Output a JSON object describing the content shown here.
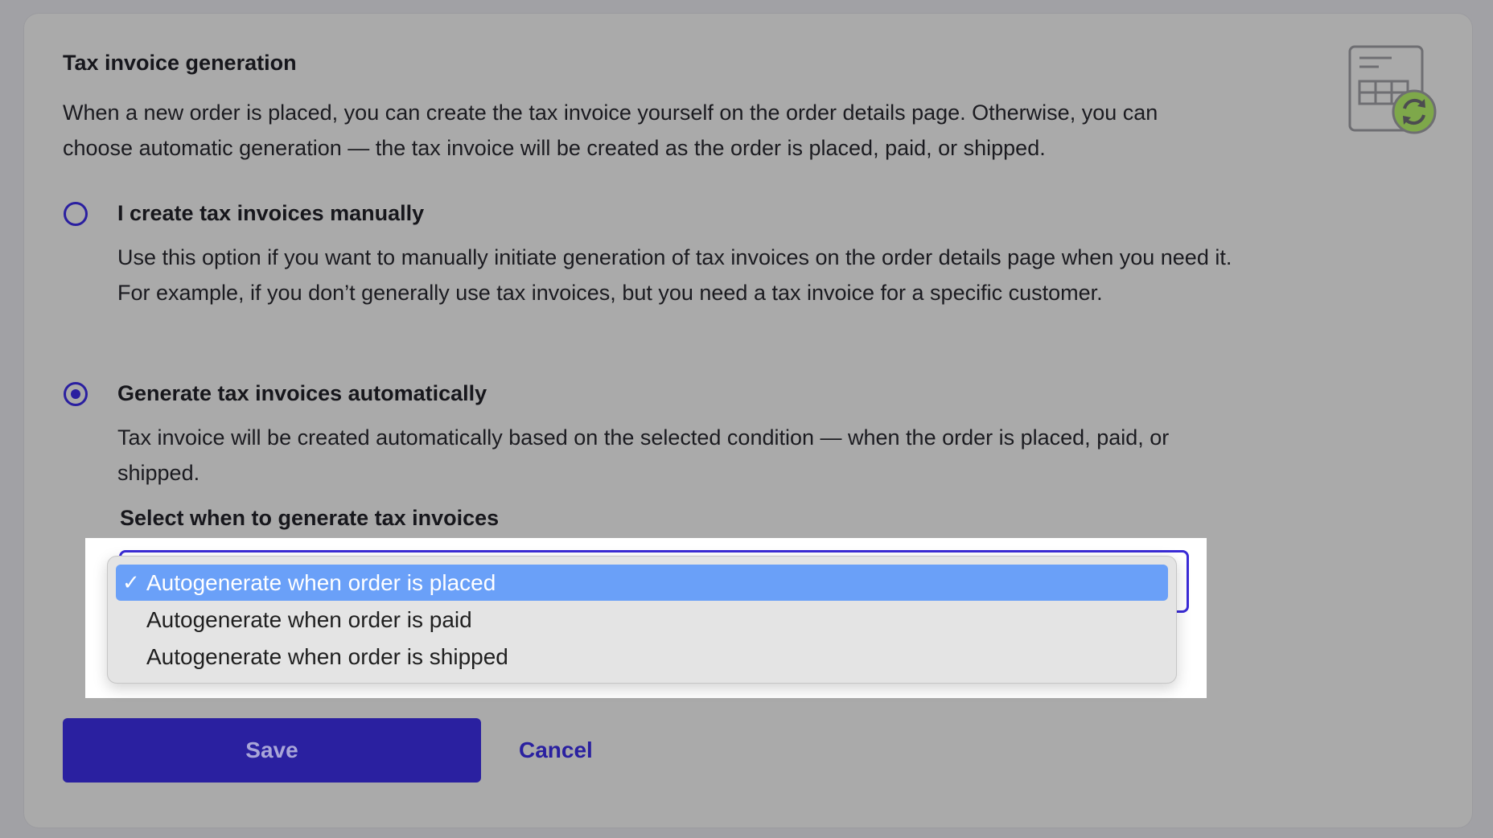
{
  "section": {
    "title": "Tax invoice generation",
    "description": "When a new order is placed, you can create the tax invoice yourself on the order details page. Otherwise, you can choose automatic generation — the tax invoice will be created as the order is placed, paid, or shipped.",
    "icon": "invoice-refresh-icon"
  },
  "options": [
    {
      "label": "I create tax invoices manually",
      "description": "Use this option if you want to manually initiate generation of tax invoices on the order details page when you need it. For example, if you don’t generally use tax invoices, but you need a tax invoice for a specific customer.",
      "selected": false
    },
    {
      "label": "Generate tax invoices automatically",
      "description": "Tax invoice will be created automatically based on the selected condition — when the order is placed, paid, or shipped.",
      "selected": true
    }
  ],
  "select": {
    "label": "Select when to generate tax invoices",
    "check_mark": "✓",
    "items": [
      {
        "label": "Autogenerate when order is placed",
        "selected": true
      },
      {
        "label": "Autogenerate when order is paid",
        "selected": false
      },
      {
        "label": "Autogenerate when order is shipped",
        "selected": false
      }
    ]
  },
  "actions": {
    "save_label": "Save",
    "cancel_label": "Cancel"
  },
  "colors": {
    "accent": "#2a20a0",
    "highlight": "#6aa0f8",
    "icon_badge": "#7ea84a"
  }
}
